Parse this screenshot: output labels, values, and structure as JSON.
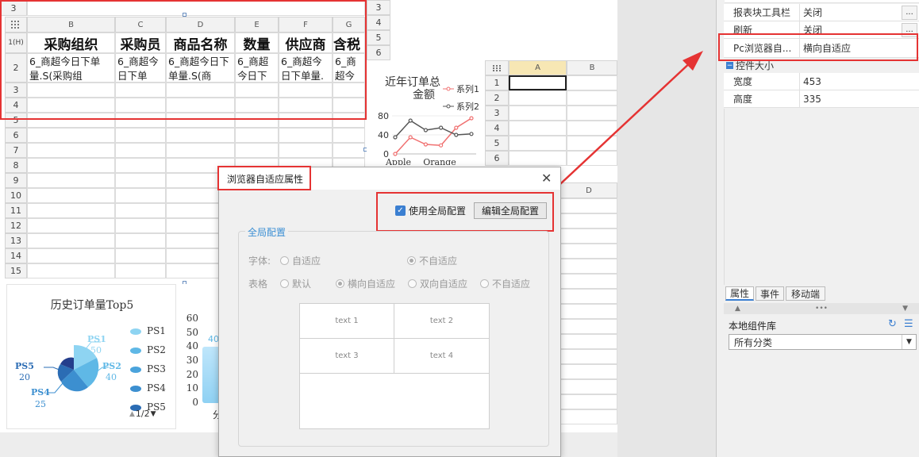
{
  "sheet": {
    "col_headers": [
      "B",
      "C",
      "D",
      "E",
      "F",
      "G"
    ],
    "row_labels": [
      "3",
      "1(H)",
      "2",
      "3",
      "4",
      "5",
      "6",
      "7",
      "8",
      "9",
      "10",
      "11",
      "12",
      "13",
      "14",
      "15"
    ],
    "header_cells": [
      "采购组织",
      "采购员",
      "商品名称",
      "数量",
      "供应商",
      "含税"
    ],
    "data_cells": [
      "6_商超今日下单量.S(采购组",
      "6_商超今日下单",
      "6_商超今日下单量.S(商",
      "6_商超今日下",
      "6_商超今日下单量.",
      "6_商超今日下"
    ],
    "corner_icon": "grid-icon"
  },
  "right_sheet": {
    "row_labels": [
      "3",
      "4",
      "5",
      "6"
    ],
    "grid_rows": [
      "1",
      "2",
      "3",
      "4",
      "5",
      "6"
    ],
    "cols": [
      "A",
      "B"
    ],
    "col_d": "D"
  },
  "line_chart": {
    "chart_data": {
      "type": "line",
      "title": "近年订单总金额",
      "categories": [
        "Apple",
        "",
        "Orange",
        "",
        ""
      ],
      "yticks": [
        0,
        40,
        80
      ],
      "ylim": [
        0,
        100
      ],
      "series": [
        {
          "name": "系列1",
          "color": "#f07070",
          "values": [
            0,
            35,
            20,
            18,
            55,
            75
          ]
        },
        {
          "name": "系列2",
          "color": "#555555",
          "values": [
            35,
            70,
            50,
            55,
            40,
            42
          ]
        }
      ]
    }
  },
  "pie_chart": {
    "title": "历史订单量Top5",
    "labels": [
      {
        "name": "PS1",
        "value": "50"
      },
      {
        "name": "PS2",
        "value": "40"
      },
      {
        "name": "PS4",
        "value": "25"
      },
      {
        "name": "PS5",
        "value": "20"
      }
    ],
    "legend": [
      "PS1",
      "PS2",
      "PS3",
      "PS4",
      "PS5"
    ],
    "pager": "1/2"
  },
  "bar_chart": {
    "yticks": [
      "60",
      "50",
      "40",
      "30",
      "20",
      "10",
      "0"
    ],
    "bar_label": "40",
    "bar_value": 40,
    "ymax": 60,
    "xlabel_partial": "分"
  },
  "dialog": {
    "title": "浏览器自适应属性",
    "use_global": "使用全局配置",
    "edit_global": "编辑全局配置",
    "group_title": "全局配置",
    "font_label": "字体:",
    "font_options": [
      "自适应",
      "不自适应"
    ],
    "table_label": "表格",
    "table_options": [
      "默认",
      "横向自适应",
      "双向自适应",
      "不自适应"
    ],
    "grid_cells": [
      "text 1",
      "text 2",
      "text 3",
      "text 4"
    ]
  },
  "props": {
    "rows": [
      {
        "key": "报表块工具栏",
        "value": "关闭"
      },
      {
        "key": "刷新",
        "value": "关闭"
      },
      {
        "key": "Pc浏览器自...",
        "value": "横向自适应"
      }
    ],
    "section": "控件大小",
    "size_rows": [
      {
        "key": "宽度",
        "value": "453"
      },
      {
        "key": "高度",
        "value": "335"
      }
    ],
    "tabs": [
      "属性",
      "事件",
      "移动端"
    ],
    "lib_title": "本地组件库",
    "lib_select": "所有分类"
  }
}
